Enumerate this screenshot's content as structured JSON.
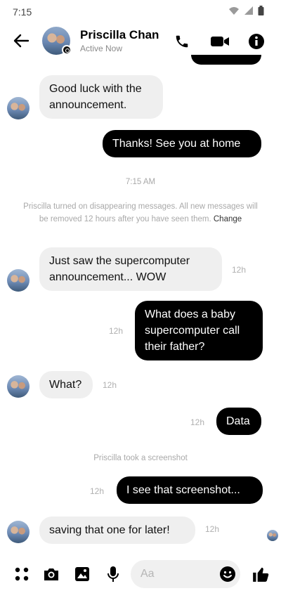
{
  "status_bar": {
    "time": "7:15",
    "icons": [
      "wifi-icon",
      "signal-icon",
      "battery-icon"
    ]
  },
  "header": {
    "contact_name": "Priscilla Chan",
    "presence": "Active Now",
    "icons": [
      "back-arrow-icon",
      "phone-icon",
      "video-camera-icon",
      "info-icon"
    ]
  },
  "messages": [
    {
      "from": "them",
      "lines": [
        "Good luck with the",
        "announcement."
      ]
    },
    {
      "from": "me",
      "lines": [
        "Thanks! See you at home"
      ]
    },
    {
      "from": "system",
      "text": "7:15 AM"
    },
    {
      "from": "system",
      "text": "Priscilla turned on disappearing messages. All new messages will be removed 12 hours after you have seen them.",
      "action": "Change"
    },
    {
      "from": "them",
      "lines": [
        "Just saw the supercomputer",
        "announcement... WOW"
      ],
      "time": "12h"
    },
    {
      "from": "me",
      "lines": [
        "What does a baby",
        "supercomputer call",
        "their father?"
      ],
      "time": "12h"
    },
    {
      "from": "them",
      "lines": [
        "What?"
      ],
      "time": "12h"
    },
    {
      "from": "me",
      "lines": [
        "Data"
      ],
      "time": "12h"
    },
    {
      "from": "system",
      "text": "Priscilla took a screenshot"
    },
    {
      "from": "me",
      "lines": [
        "I see that screenshot..."
      ],
      "time": "12h"
    },
    {
      "from": "them",
      "lines": [
        "saving that one for later!"
      ],
      "time": "12h"
    }
  ],
  "composer": {
    "placeholder": "Aa",
    "icons": [
      "apps-icon",
      "camera-icon",
      "gallery-icon",
      "microphone-icon",
      "emoji-icon",
      "thumbs-up-icon"
    ]
  }
}
